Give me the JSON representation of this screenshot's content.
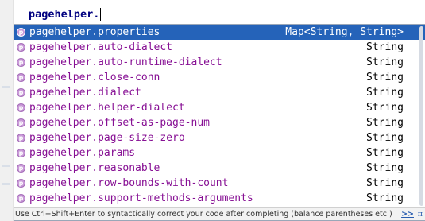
{
  "editor": {
    "line_text": "pagehelper."
  },
  "popup": {
    "items": [
      {
        "name": "pagehelper.properties",
        "type": "Map<String, String>",
        "icon": "property-icon",
        "icon_letter": "p",
        "selected": true
      },
      {
        "name": "pagehelper.auto-dialect",
        "type": "String",
        "icon": "property-icon",
        "icon_letter": "p"
      },
      {
        "name": "pagehelper.auto-runtime-dialect",
        "type": "String",
        "icon": "property-icon",
        "icon_letter": "p"
      },
      {
        "name": "pagehelper.close-conn",
        "type": "String",
        "icon": "property-icon",
        "icon_letter": "p"
      },
      {
        "name": "pagehelper.dialect",
        "type": "String",
        "icon": "property-icon",
        "icon_letter": "p"
      },
      {
        "name": "pagehelper.helper-dialect",
        "type": "String",
        "icon": "property-icon",
        "icon_letter": "p"
      },
      {
        "name": "pagehelper.offset-as-page-num",
        "type": "String",
        "icon": "property-icon",
        "icon_letter": "p"
      },
      {
        "name": "pagehelper.page-size-zero",
        "type": "String",
        "icon": "property-icon",
        "icon_letter": "p"
      },
      {
        "name": "pagehelper.params",
        "type": "String",
        "icon": "property-icon",
        "icon_letter": "p"
      },
      {
        "name": "pagehelper.reasonable",
        "type": "String",
        "icon": "property-icon",
        "icon_letter": "p"
      },
      {
        "name": "pagehelper.row-bounds-with-count",
        "type": "String",
        "icon": "property-icon",
        "icon_letter": "p"
      },
      {
        "name": "pagehelper.support-methods-arguments",
        "type": "String",
        "icon": "property-icon",
        "icon_letter": "p"
      }
    ],
    "status_hint": "Use Ctrl+Shift+Enter to syntactically correct your code after completing (balance parentheses etc.)",
    "more_link": ">>",
    "pi_symbol": "π"
  },
  "colors": {
    "selection": "#2563b9",
    "property_name": "#871094",
    "editor_text": "#000080"
  }
}
